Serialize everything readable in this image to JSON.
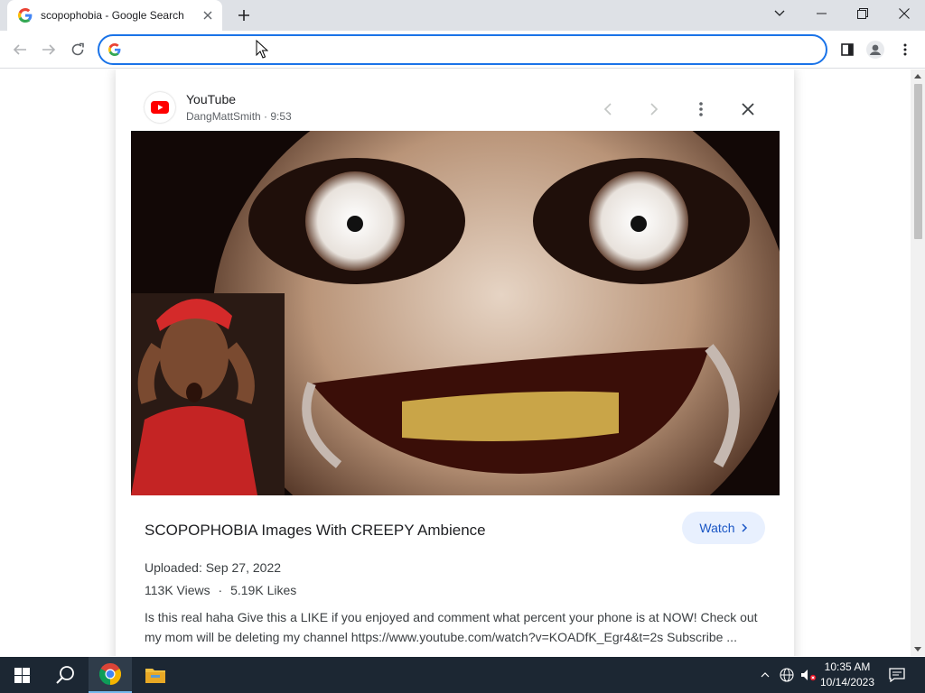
{
  "browser": {
    "tab_title": "scopophobia - Google Search",
    "omnibox_value": "",
    "omnibox_placeholder": ""
  },
  "panel": {
    "source_name": "YouTube",
    "channel": "DangMattSmith",
    "duration": "9:53",
    "video_title": "SCOPOPHOBIA Images With CREEPY Ambience",
    "watch_label": "Watch",
    "uploaded": "Uploaded: Sep 27, 2022",
    "views": "113K Views",
    "likes": "5.19K Likes",
    "description": "Is this real haha Give this a LIKE if you enjoyed and comment what percent your phone is at NOW! Check out my mom will be deleting my channel https://www.youtube.com/watch?v=KOADfK_Egr4&t=2s Subscribe ..."
  },
  "taskbar": {
    "time": "10:35 AM",
    "date": "10/14/2023"
  },
  "colors": {
    "accent": "#1a73e8",
    "youtube_red": "#ff0000",
    "taskbar": "#1c2733"
  },
  "icons": [
    "google-icon",
    "close-icon",
    "plus-icon",
    "chevron-down-icon",
    "minimize-icon",
    "restore-icon",
    "back-icon",
    "forward-icon",
    "reload-icon",
    "side-panel-icon",
    "profile-icon",
    "more-vert-icon",
    "youtube-icon",
    "chevron-left-icon",
    "chevron-right-icon",
    "windows-icon",
    "search-icon",
    "chrome-icon",
    "file-explorer-icon",
    "notifications-icon"
  ]
}
